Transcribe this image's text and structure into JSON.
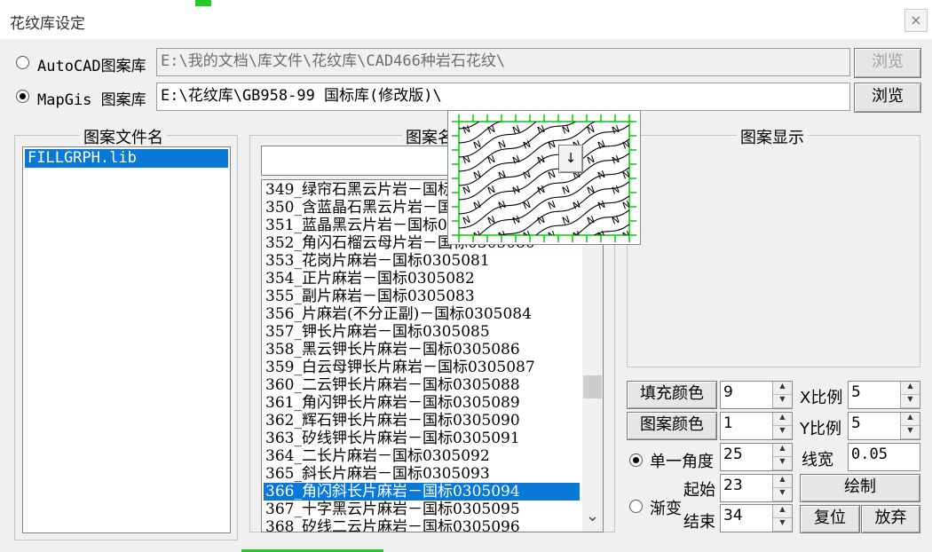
{
  "window": {
    "title": "花纹库设定",
    "close_icon": "close-icon",
    "close_glyph": "×"
  },
  "sources": {
    "autocad": {
      "label": "AutoCAD图案库",
      "path": "E:\\我的文档\\库文件\\花纹库\\CAD466种岩石花纹\\",
      "browse": "浏览",
      "selected": false
    },
    "mapgis": {
      "label": "MapGis 图案库",
      "path": "E:\\花纹库\\GB958-99 国标库(修改版)\\",
      "browse": "浏览",
      "selected": true
    }
  },
  "file_group": {
    "title": "图案文件名",
    "files": [
      "FILLGRPH.lib"
    ],
    "selected": 0
  },
  "name_group": {
    "title": "图案名",
    "search_value": "",
    "items": [
      "349_绿帘石黑云片岩－国标0305077",
      "350_含蓝晶石黑云片岩－国标0305078",
      "351_蓝晶黑云片岩－国标0305079",
      "352_角闪石榴云母片岩－国标0305080",
      "353_花岗片麻岩－国标0305081",
      "354_正片麻岩－国标0305082",
      "355_副片麻岩－国标0305083",
      "356_片麻岩(不分正副)－国标0305084",
      "357_钾长片麻岩－国标0305085",
      "358_黑云钾长片麻岩－国标0305086",
      "359_白云母钾长片麻岩－国标0305087",
      "360_二云钾长片麻岩－国标0305088",
      "361_角闪钾长片麻岩－国标0305089",
      "362_辉石钾长片麻岩－国标0305090",
      "363_矽线钾长片麻岩－国标0305091",
      "364_二长片麻岩－国标0305092",
      "365_斜长片麻岩－国标0305093",
      "366_角闪斜长片麻岩－国标0305094",
      "367_十字黑云片麻岩－国标0305095",
      "368_矽线二云片麻岩－国标0305096"
    ],
    "selected_index": 17,
    "scroll_down_icon": "chevron-down-icon",
    "scroll_glyph": "⌄"
  },
  "preview_popup": {
    "pattern_glyph": "N",
    "dropdown_glyph": "↓",
    "pattern_color": "#000000",
    "grid_color": "#00cc00"
  },
  "display_group": {
    "title": "图案显示"
  },
  "controls": {
    "fill_color": {
      "label": "填充颜色",
      "value": "9"
    },
    "pattern_color": {
      "label": "图案颜色",
      "value": "1"
    },
    "x_scale": {
      "label": "X比例",
      "value": "5"
    },
    "y_scale": {
      "label": "Y比例",
      "value": "5"
    },
    "line_width": {
      "label": "线宽",
      "value": "0.05"
    },
    "single_angle": {
      "label": "单一角度",
      "value": "25",
      "selected": true
    },
    "gradient": {
      "label": "渐变",
      "selected": false
    },
    "start": {
      "label": "起始",
      "value": "23"
    },
    "end": {
      "label": "结束",
      "value": "34"
    },
    "draw_button": "绘制",
    "reset_button": "复位",
    "discard_button": "放弃",
    "spin_up": "▲",
    "spin_down": "▼"
  },
  "colors": {
    "selection": "#0a78d7",
    "accent_green": "#22cc22"
  }
}
